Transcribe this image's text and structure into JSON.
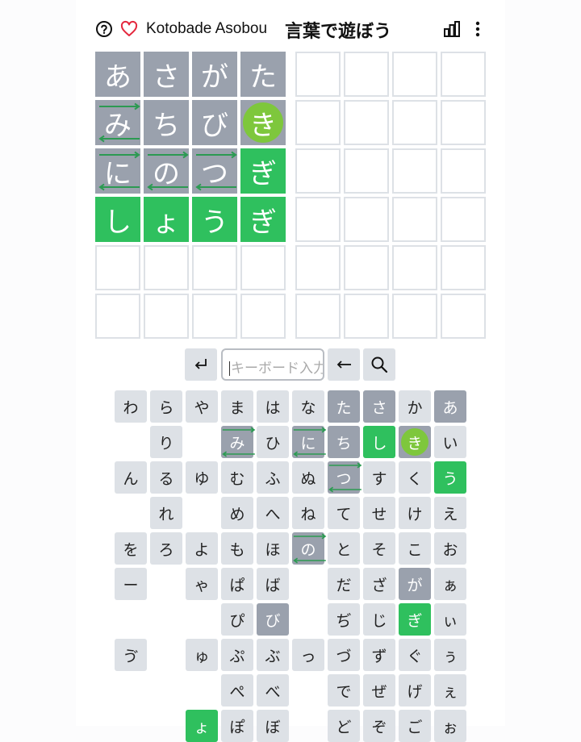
{
  "header": {
    "title_en": "Kotobade Asobou",
    "title_jp": "言葉で遊ぼう",
    "icons": [
      "help-icon",
      "heart-icon",
      "stats-icon",
      "more-icon"
    ]
  },
  "colors": {
    "gray": "#9aa1ad",
    "green": "#2fc05e",
    "lime_circle": "#7ec73c",
    "empty_border": "#dde1e6",
    "key_bg": "#dde1e6",
    "arrow": "#2c9a52"
  },
  "board": {
    "rows": [
      [
        {
          "ch": "あ",
          "s": "gray"
        },
        {
          "ch": "さ",
          "s": "gray"
        },
        {
          "ch": "が",
          "s": "gray"
        },
        {
          "ch": "た",
          "s": "gray"
        }
      ],
      [
        {
          "ch": "み",
          "s": "gray",
          "arrows": true
        },
        {
          "ch": "ち",
          "s": "gray"
        },
        {
          "ch": "び",
          "s": "gray"
        },
        {
          "ch": "き",
          "s": "circle"
        }
      ],
      [
        {
          "ch": "に",
          "s": "gray",
          "arrows": true
        },
        {
          "ch": "の",
          "s": "gray",
          "arrows": true
        },
        {
          "ch": "つ",
          "s": "gray",
          "arrows": true
        },
        {
          "ch": "ぎ",
          "s": "green"
        }
      ],
      [
        {
          "ch": "し",
          "s": "green"
        },
        {
          "ch": "ょ",
          "s": "green"
        },
        {
          "ch": "う",
          "s": "green"
        },
        {
          "ch": "ぎ",
          "s": "green"
        }
      ],
      [
        {
          "ch": "",
          "s": "empty"
        },
        {
          "ch": "",
          "s": "empty"
        },
        {
          "ch": "",
          "s": "empty"
        },
        {
          "ch": "",
          "s": "empty"
        }
      ],
      [
        {
          "ch": "",
          "s": "empty"
        },
        {
          "ch": "",
          "s": "empty"
        },
        {
          "ch": "",
          "s": "empty"
        },
        {
          "ch": "",
          "s": "empty"
        }
      ]
    ],
    "right_rows": 6,
    "right_cols": 4
  },
  "controls": {
    "enter_icon": "enter-icon",
    "input_placeholder": "キーボード入力",
    "backspace_icon": "backspace-icon",
    "search_icon": "search-icon"
  },
  "keyboard": {
    "columns": [
      [
        "わ",
        "",
        "ん",
        "",
        "を",
        "ー",
        "",
        "ゔ",
        "",
        ""
      ],
      [
        "ら",
        "り",
        "る",
        "れ",
        "ろ",
        "",
        "",
        "",
        "",
        ""
      ],
      [
        "や",
        "",
        "ゆ",
        "",
        "よ",
        "ゃ",
        "",
        "ゅ",
        "",
        "ょ"
      ],
      [
        "ま",
        "み",
        "む",
        "め",
        "も",
        "ぱ",
        "ぴ",
        "ぷ",
        "ぺ",
        "ぽ"
      ],
      [
        "は",
        "ひ",
        "ふ",
        "へ",
        "ほ",
        "ば",
        "び",
        "ぶ",
        "べ",
        "ぼ"
      ],
      [
        "な",
        "に",
        "ぬ",
        "ね",
        "の",
        "",
        "",
        "っ",
        "",
        ""
      ],
      [
        "た",
        "ち",
        "つ",
        "て",
        "と",
        "だ",
        "ぢ",
        "づ",
        "で",
        "ど"
      ],
      [
        "さ",
        "し",
        "す",
        "せ",
        "そ",
        "ざ",
        "じ",
        "ず",
        "ぜ",
        "ぞ"
      ],
      [
        "か",
        "き",
        "く",
        "け",
        "こ",
        "が",
        "ぎ",
        "ぐ",
        "げ",
        "ご"
      ],
      [
        "あ",
        "い",
        "う",
        "え",
        "お",
        "ぁ",
        "ぃ",
        "ぅ",
        "ぇ",
        "ぉ"
      ]
    ],
    "states": {
      "た": "gray",
      "さ": "gray",
      "あ": "gray",
      "ち": "gray",
      "が": "gray",
      "び": "gray",
      "し": "green",
      "う": "green",
      "ぎ": "green",
      "ょ": "green",
      "き": "circle",
      "み": "arrows",
      "に": "arrows",
      "つ": "arrows",
      "の": "arrows"
    }
  }
}
